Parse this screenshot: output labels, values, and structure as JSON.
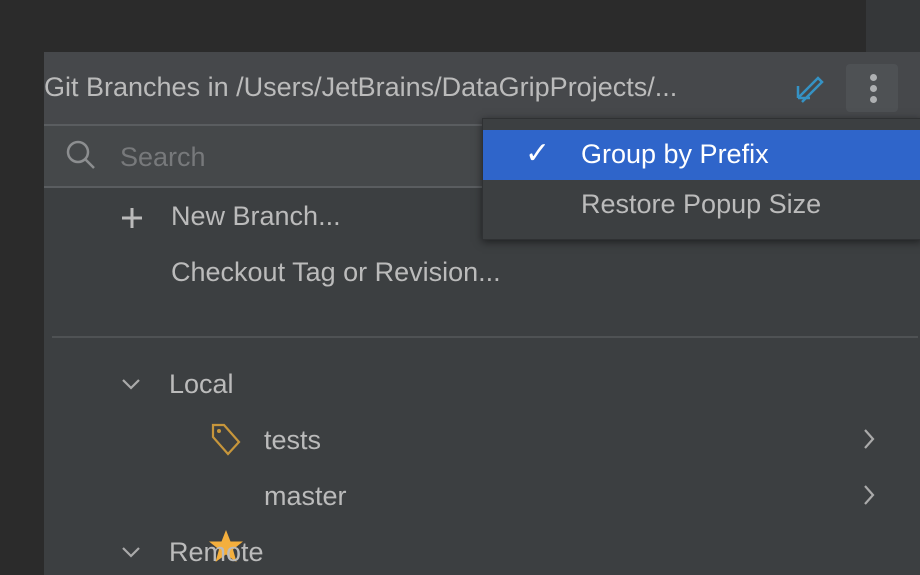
{
  "popup": {
    "title": "Git Branches in /Users/JetBrains/DataGripProjects/...",
    "search_placeholder": "Search",
    "actions": [
      {
        "label": "New Branch..."
      },
      {
        "label": "Checkout Tag or Revision..."
      }
    ],
    "groups": [
      {
        "label": "Local",
        "items": [
          {
            "label": "tests",
            "icon": "tag-icon"
          },
          {
            "label": "master",
            "icon": "star-icon"
          }
        ]
      },
      {
        "label": "Remote"
      }
    ]
  },
  "menu": {
    "items": [
      {
        "label": "Group by Prefix",
        "checked": true,
        "check": "✓"
      },
      {
        "label": "Restore Popup Size",
        "checked": false
      }
    ]
  },
  "colors": {
    "accent": "#2f65ca",
    "star": "#f4af3d",
    "tag": "#c7963b",
    "pin": "#3592c4"
  }
}
